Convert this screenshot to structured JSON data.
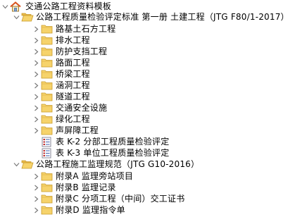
{
  "tree": {
    "root": {
      "label": "交通公路工程资料模板"
    },
    "jtg_f80": {
      "label": "公路工程质量检验评定标准 第一册 土建工程（JTG F80/1-2017）",
      "children": [
        {
          "label": "路基土石方工程"
        },
        {
          "label": "排水工程"
        },
        {
          "label": "防护支挡工程"
        },
        {
          "label": "路面工程"
        },
        {
          "label": "桥梁工程"
        },
        {
          "label": "涵洞工程"
        },
        {
          "label": "隧道工程"
        },
        {
          "label": "交通安全设施"
        },
        {
          "label": "绿化工程"
        },
        {
          "label": "声屏障工程"
        }
      ],
      "forms": [
        {
          "label": "表 K-2  分部工程质量检验评定"
        },
        {
          "label": "表 K-3  单位工程质量检验评定"
        }
      ]
    },
    "jtg_g10": {
      "label": "公路工程施工监理规范（JTG G10-2016）",
      "children": [
        {
          "label": "附录A 监理旁站项目"
        },
        {
          "label": "附录B 监理记录"
        },
        {
          "label": "附录C 分项工程（中间）交工证书"
        },
        {
          "label": "附录D 监理指令单"
        }
      ]
    }
  },
  "icons": {
    "home": "home-icon",
    "folder": "folder-icon",
    "folder_open": "folder-open-icon",
    "document": "form-document-icon",
    "expanded": "chevron-down-icon",
    "collapsed": "chevron-right-icon"
  },
  "colors": {
    "folder_fill": "#f6d36b",
    "folder_edge": "#c89a2a",
    "house_roof": "#d9531e",
    "arrow": "#808080"
  }
}
